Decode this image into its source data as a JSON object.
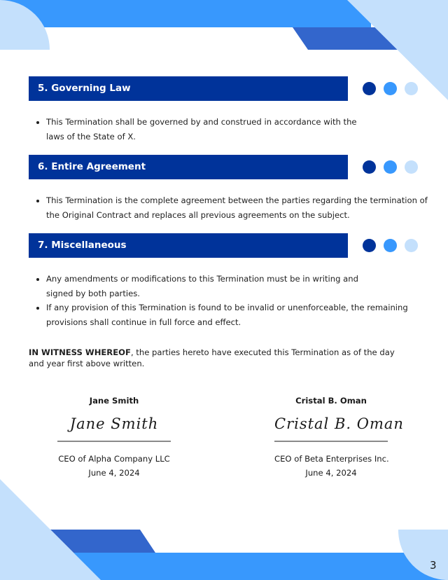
{
  "colors": {
    "navy": "#00339a",
    "bright_blue": "#3898fd",
    "mid_blue": "#3366cc",
    "light_blue": "#c4e0fc"
  },
  "sections": [
    {
      "title": "5. Governing Law",
      "bullets": [
        "This Termination shall be governed by and construed in accordance with the laws of the State of X."
      ]
    },
    {
      "title": "6. Entire Agreement",
      "bullets": [
        "This Termination is the complete agreement between the parties regarding the termination of the Original Contract and replaces all previous agreements on the subject."
      ]
    },
    {
      "title": "7. Miscellaneous",
      "bullets": [
        "Any amendments or modifications to this Termination must be in writing and signed by both parties.",
        "If any provision of this Termination is found to be invalid or unenforceable, the remaining provisions shall continue in full force and effect."
      ]
    }
  ],
  "witness": {
    "lead": "IN WITNESS WHEREOF",
    "text": ", the parties hereto have executed this Termination as of the day and year first above written."
  },
  "signatories": [
    {
      "name": "Jane Smith",
      "signature": "Jane Smith",
      "title": "CEO of Alpha Company LLC",
      "date": "June 4, 2024"
    },
    {
      "name": "Cristal B. Oman",
      "signature": "Cristal B. Oman",
      "title": "CEO of Beta Enterprises Inc.",
      "date": "June 4, 2024"
    }
  ],
  "page_number": "3"
}
